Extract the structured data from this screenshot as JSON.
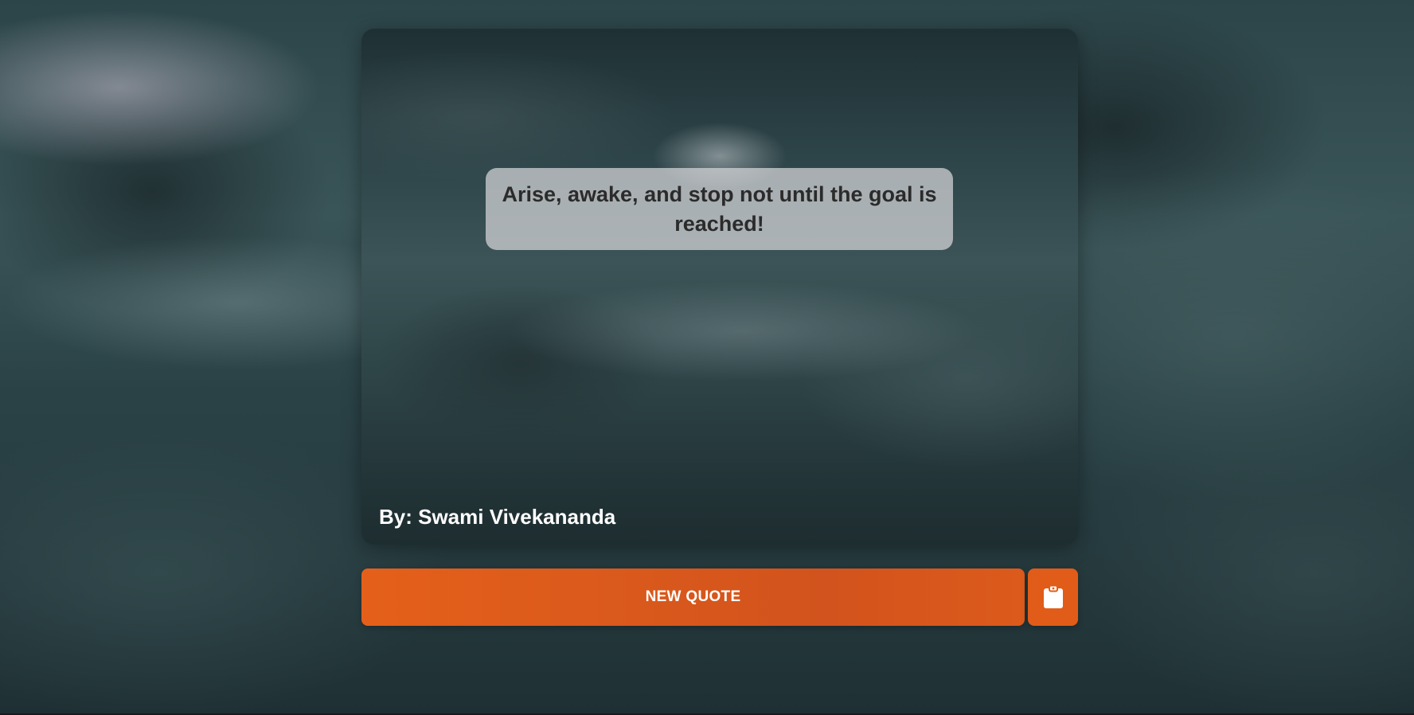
{
  "quote": {
    "text": "Arise, awake, and stop not until the goal is reached!",
    "author": "By: Swami Vivekananda"
  },
  "actions": {
    "new_quote_label": "NEW QUOTE",
    "copy_icon": "clipboard-icon"
  },
  "colors": {
    "accent": "#e15c18",
    "quote_box": "#d7d7da",
    "quote_text": "#2b2b2b",
    "author_text": "#ffffff"
  }
}
